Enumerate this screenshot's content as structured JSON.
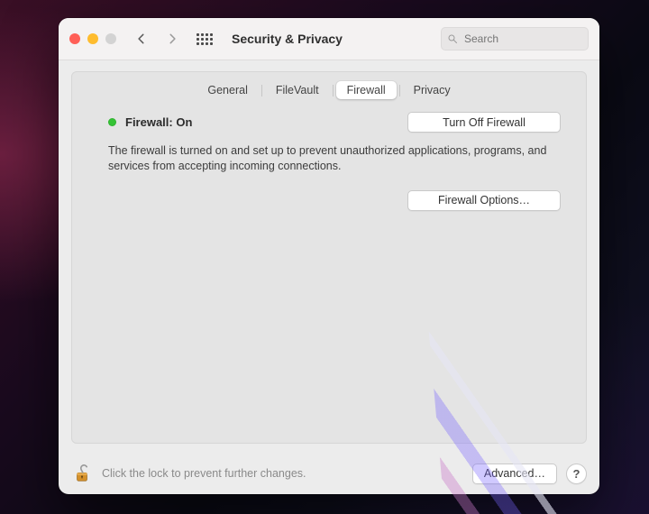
{
  "header": {
    "title": "Security & Privacy",
    "search_placeholder": "Search"
  },
  "tabs": {
    "items": [
      "General",
      "FileVault",
      "Firewall",
      "Privacy"
    ],
    "selected_index": 2
  },
  "firewall": {
    "status_label": "Firewall: On",
    "status_color": "#35c335",
    "toggle_button": "Turn Off Firewall",
    "description": "The firewall is turned on and set up to prevent unauthorized applications, programs, and services from accepting incoming connections.",
    "options_button": "Firewall Options…"
  },
  "footer": {
    "lock_hint": "Click the lock to prevent further changes.",
    "advanced_button": "Advanced…",
    "help_label": "?"
  }
}
